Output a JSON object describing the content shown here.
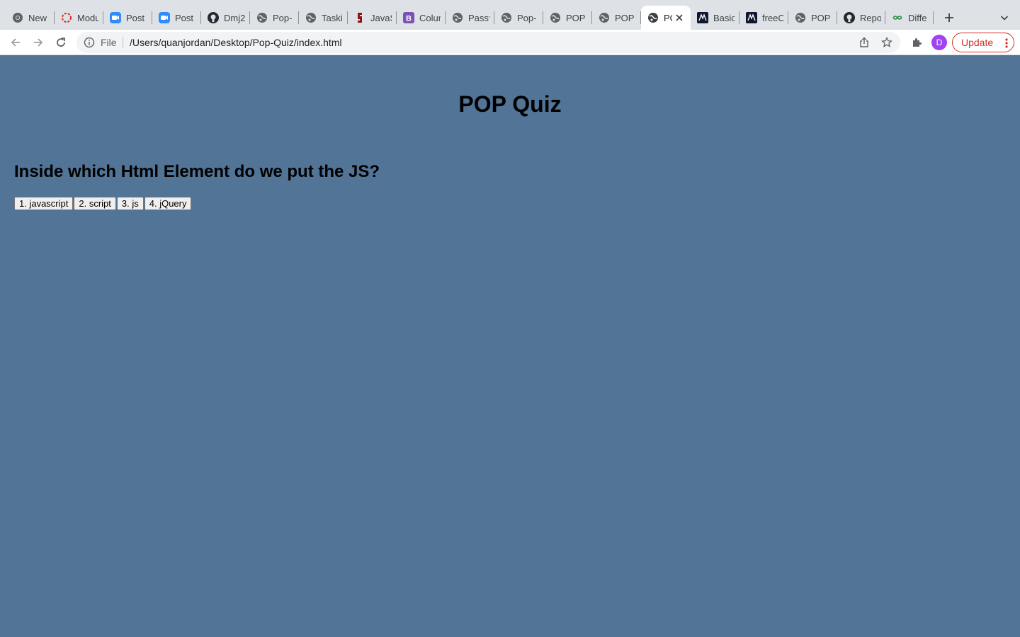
{
  "browser": {
    "tabs": [
      {
        "title": "New",
        "favicon": "chrome-icon"
      },
      {
        "title": "Modu",
        "favicon": "ring-icon"
      },
      {
        "title": "Post",
        "favicon": "zoom-icon"
      },
      {
        "title": "Post",
        "favicon": "zoom-icon"
      },
      {
        "title": "Dmj2",
        "favicon": "github-icon"
      },
      {
        "title": "Pop-",
        "favicon": "globe-icon"
      },
      {
        "title": "Taski",
        "favicon": "globe-icon"
      },
      {
        "title": "JavaS",
        "favicon": "stanford-icon"
      },
      {
        "title": "Colur",
        "favicon": "bootstrap-icon"
      },
      {
        "title": "Passv",
        "favicon": "globe-icon"
      },
      {
        "title": "Pop-",
        "favicon": "globe-icon"
      },
      {
        "title": "POP",
        "favicon": "globe-icon"
      },
      {
        "title": "POP",
        "favicon": "globe-icon"
      },
      {
        "title": "PO",
        "favicon": "globe-icon",
        "active": true
      },
      {
        "title": "Basic",
        "favicon": "codecademy-icon"
      },
      {
        "title": "freeC",
        "favicon": "codecademy-icon"
      },
      {
        "title": "POP",
        "favicon": "globe-icon"
      },
      {
        "title": "Repo",
        "favicon": "github-icon"
      },
      {
        "title": "Diffe",
        "favicon": "geeks-icon"
      }
    ],
    "omnibox": {
      "scheme_label": "File",
      "url": "/Users/quanjordan/Desktop/Pop-Quiz/index.html"
    },
    "profile_initial": "D",
    "update_label": "Update",
    "colors": {
      "accent_red": "#d93025",
      "profile": "#a142f4",
      "page_bg": "#517497"
    }
  },
  "page": {
    "title": "POP Quiz",
    "question": "Inside which Html Element do we put the JS?",
    "answers": [
      "1. javascript",
      "2. script",
      "3. js",
      "4. jQuery"
    ]
  }
}
